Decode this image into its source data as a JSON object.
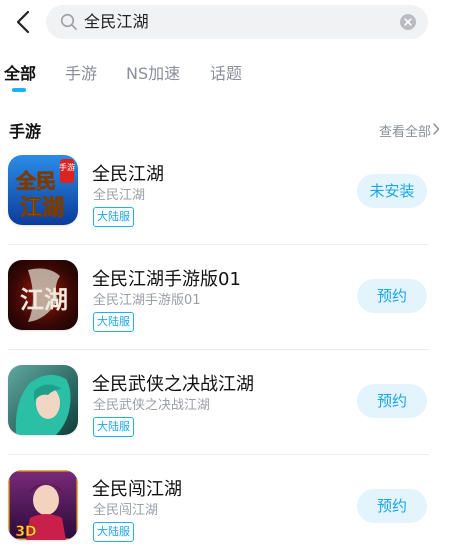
{
  "search": {
    "query": "全民江湖"
  },
  "tabs": [
    {
      "label": "全部",
      "active": true
    },
    {
      "label": "手游",
      "active": false
    },
    {
      "label": "NS加速",
      "active": false
    },
    {
      "label": "话题",
      "active": false
    }
  ],
  "section": {
    "title": "手游",
    "view_all": "查看全部"
  },
  "items": [
    {
      "name": "全民江湖",
      "subtitle": "全民江湖",
      "badge": "大陆服",
      "action": "未安装",
      "icon": "game-icon-quanmin-jianghu",
      "icon_text": [
        "全民",
        "江湖"
      ],
      "icon_tag": "手游"
    },
    {
      "name": "全民江湖手游版01",
      "subtitle": "全民江湖手游版01",
      "badge": "大陆服",
      "action": "预约",
      "icon": "game-icon-jianghu-mobile",
      "icon_text": [
        "江湖"
      ]
    },
    {
      "name": "全民武侠之决战江湖",
      "subtitle": "全民武侠之决战江湖",
      "badge": "大陆服",
      "action": "预约",
      "icon": "game-icon-wuxia-green-hair"
    },
    {
      "name": "全民闯江湖",
      "subtitle": "全民闯江湖",
      "badge": "大陆服",
      "action": "预约",
      "icon": "game-icon-chuang-jianghu",
      "icon_text": [
        "3D"
      ]
    }
  ],
  "colors": {
    "accent": "#1ab2f0",
    "button_bg": "#e3f4fd",
    "button_text": "#1aa6e8",
    "muted": "#8a8f99"
  }
}
